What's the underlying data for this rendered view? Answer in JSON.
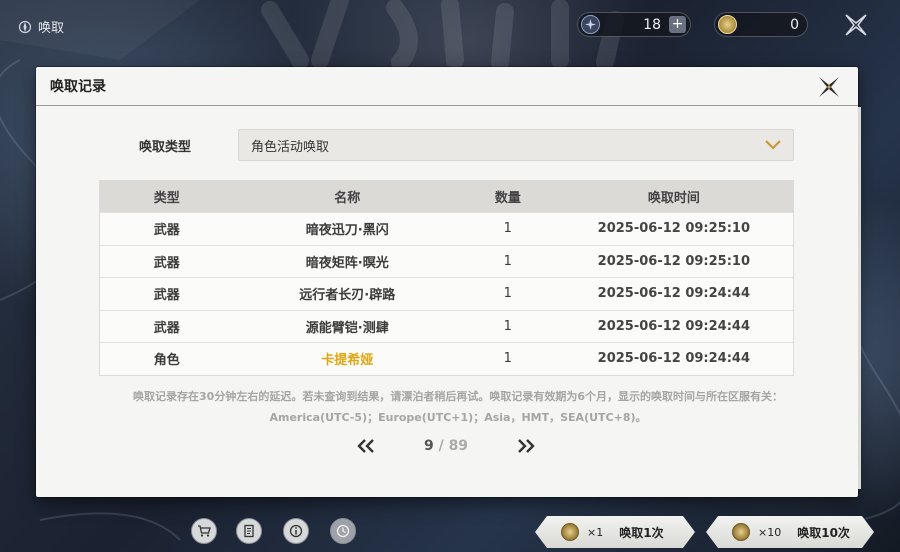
{
  "top_bar": {
    "title": "唤取",
    "star_currency": "18",
    "coin_currency": "0"
  },
  "dialog": {
    "title": "唤取记录",
    "filter_label": "唤取类型",
    "filter_value": "角色活动唤取",
    "columns": [
      "类型",
      "名称",
      "数量",
      "唤取时间"
    ],
    "rows": [
      {
        "type": "武器",
        "name": "暗夜迅刀·黑闪",
        "qty": "1",
        "time": "2025-06-12 09:25:10"
      },
      {
        "type": "武器",
        "name": "暗夜矩阵·暝光",
        "qty": "1",
        "time": "2025-06-12 09:25:10"
      },
      {
        "type": "武器",
        "name": "远行者长刃·辟路",
        "qty": "1",
        "time": "2025-06-12 09:24:44"
      },
      {
        "type": "武器",
        "name": "源能臂铠·测肆",
        "qty": "1",
        "time": "2025-06-12 09:24:44"
      },
      {
        "type": "角色",
        "name": "卡提希娅",
        "qty": "1",
        "time": "2025-06-12 09:24:44"
      }
    ],
    "note_line1": "唤取记录存在30分钟左右的延迟。若未查询到结果，请漂泊者稍后再试。唤取记录有效期为6个月，显示的唤取时间与所在区服有关：",
    "note_line2": "America(UTC-5)；Europe(UTC+1)；Asia，HMT，SEA(UTC+8)。",
    "page_current": "9",
    "page_sep": "/",
    "page_total": "89"
  },
  "bottom_bar": {
    "pull_one_mult": "×1",
    "pull_one_label": "唤取1次",
    "pull_ten_mult": "×10",
    "pull_ten_label": "唤取10次"
  },
  "colors": {
    "five_star_name": "#e0a713",
    "accent_gold": "#c89a3c"
  }
}
